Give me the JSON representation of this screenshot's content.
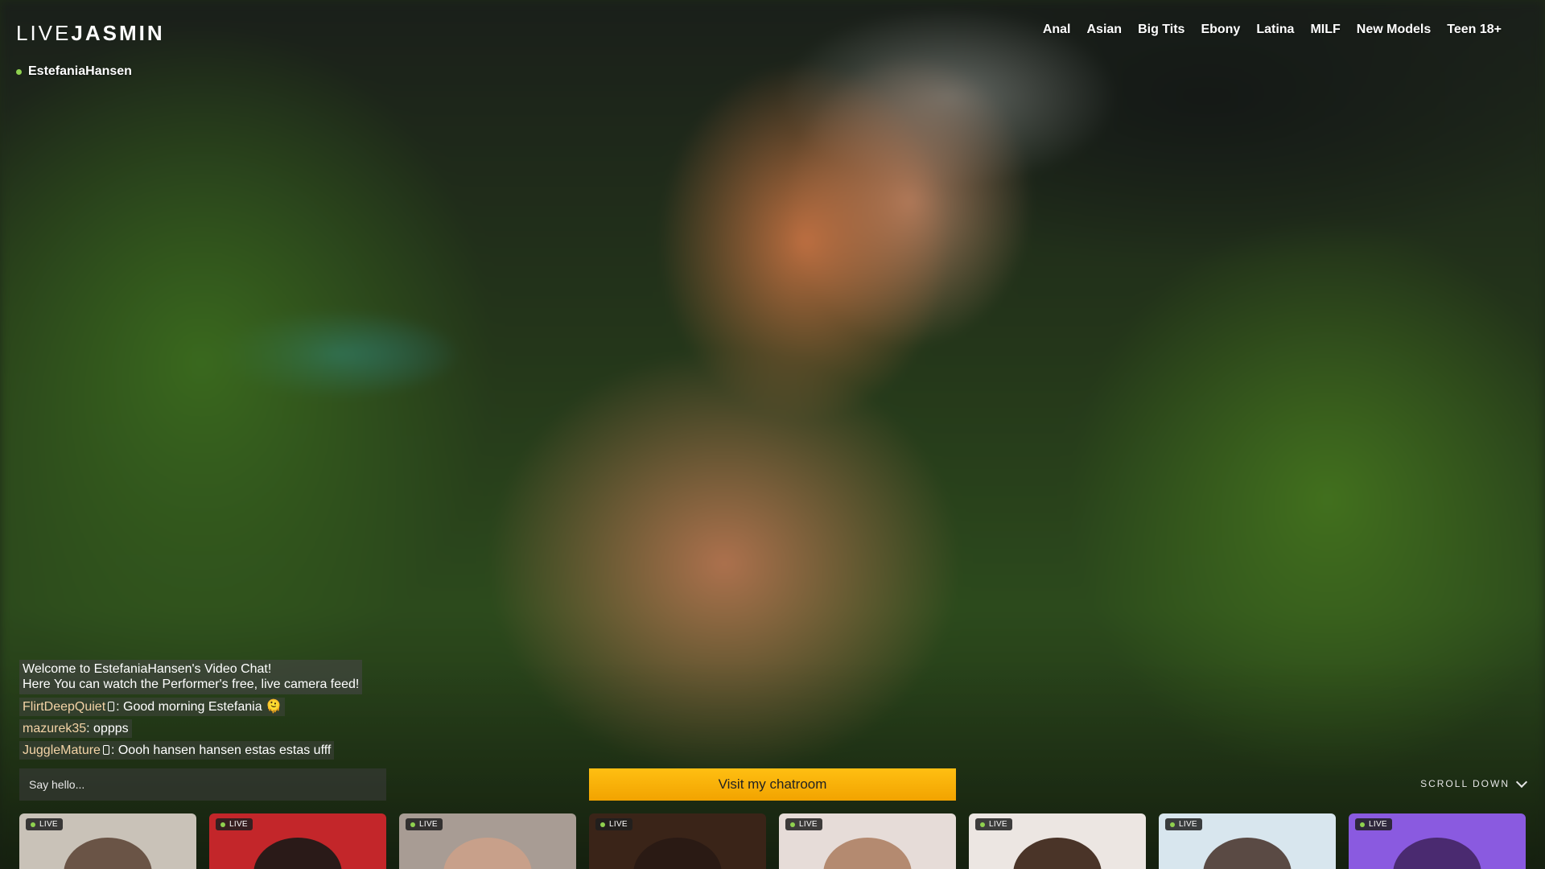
{
  "logo": {
    "part1": "LIVE",
    "part2": "JASMIN"
  },
  "nav": {
    "items": [
      "Anal",
      "Asian",
      "Big Tits",
      "Ebony",
      "Latina",
      "MILF",
      "New Models",
      "Teen 18+"
    ]
  },
  "performer": {
    "name": "EstefaniaHansen",
    "status_color": "#8fd14f"
  },
  "chat": {
    "welcome_line1": "Welcome to EstefaniaHansen's Video Chat!",
    "welcome_line2": "Here You can watch the Performer's free, live camera feed!",
    "messages": [
      {
        "user": "FlirtDeepQuiet",
        "mobile": true,
        "text": ": Good morning Estefania 🫠"
      },
      {
        "user": "mazurek35",
        "mobile": false,
        "text": ": oppps"
      },
      {
        "user": "JuggleMature",
        "mobile": true,
        "text": ": Oooh hansen hansen estas estas ufff"
      }
    ]
  },
  "input": {
    "placeholder": "Say hello..."
  },
  "visit_button": {
    "label": "Visit my chatroom",
    "color": "#ffb300"
  },
  "scroll_down": {
    "label": "SCROLL DOWN"
  },
  "cards": [
    {
      "badge": "LIVE",
      "bg": "#c9c2b8",
      "fig": "#6a5446"
    },
    {
      "badge": "LIVE",
      "bg": "#c3262a",
      "fig": "#2a1a18"
    },
    {
      "badge": "LIVE",
      "bg": "#a89c94",
      "fig": "#c8a08a"
    },
    {
      "badge": "LIVE",
      "bg": "#3a2418",
      "fig": "#2a1a14"
    },
    {
      "badge": "LIVE",
      "bg": "#e6dcd8",
      "fig": "#b48a70"
    },
    {
      "badge": "LIVE",
      "bg": "#ece6e2",
      "fig": "#4a3428"
    },
    {
      "badge": "LIVE",
      "bg": "#d8e6ee",
      "fig": "#5a4a44"
    },
    {
      "badge": "LIVE",
      "bg": "#8a5ae0",
      "fig": "#4a2a70"
    }
  ]
}
